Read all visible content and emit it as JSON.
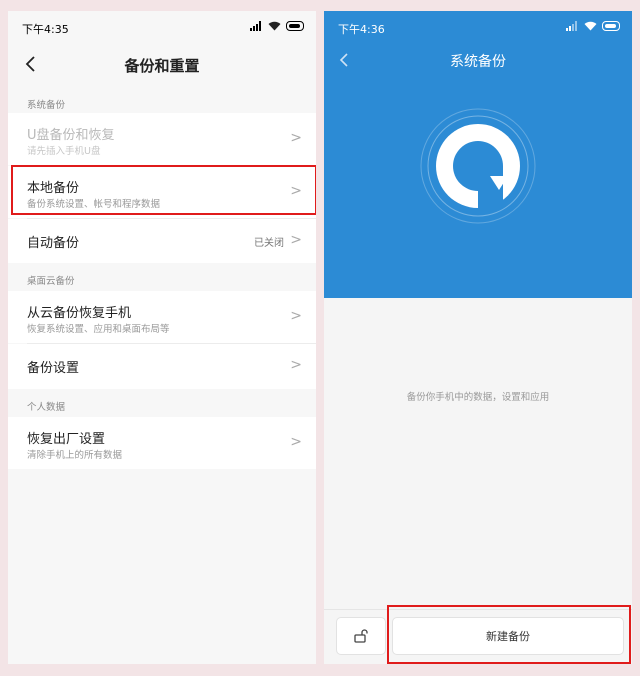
{
  "left": {
    "status": {
      "time": "下午4:35"
    },
    "title": "备份和重置",
    "sections": [
      {
        "label": "系统备份"
      },
      {
        "label": "桌面云备份"
      },
      {
        "label": "个人数据"
      }
    ],
    "items": [
      {
        "title": "U盘备份和恢复",
        "subtitle": "请先插入手机U盘"
      },
      {
        "title": "本地备份",
        "subtitle": "备份系统设置、帐号和程序数据"
      },
      {
        "title": "自动备份",
        "value": "已关闭"
      },
      {
        "title": "从云备份恢复手机",
        "subtitle": "恢复系统设置、应用和桌面布局等"
      },
      {
        "title": "备份设置"
      },
      {
        "title": "恢复出厂设置",
        "subtitle": "清除手机上的所有数据"
      }
    ]
  },
  "right": {
    "status": {
      "time": "下午4:36"
    },
    "title": "系统备份",
    "description": "备份你手机中的数据，设置和应用",
    "new_backup_label": "新建备份"
  },
  "colors": {
    "accent_blue": "#2c8bd5",
    "highlight_red": "#e01b1b"
  },
  "icons": [
    "back-arrow-icon",
    "chevron-right-icon",
    "signal-icon",
    "wifi-icon",
    "battery-icon",
    "backup-logo-icon",
    "unlock-icon"
  ]
}
